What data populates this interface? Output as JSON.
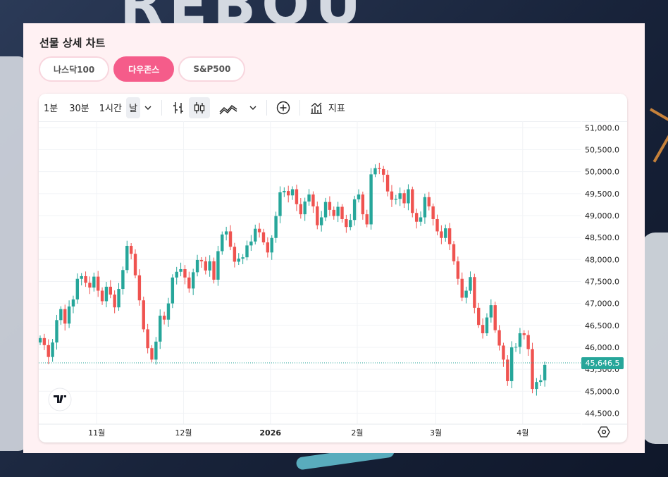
{
  "panel": {
    "title": "선물 상세 차트"
  },
  "tabs": [
    {
      "label": "나스닥100",
      "active": false
    },
    {
      "label": "다우존스",
      "active": true
    },
    {
      "label": "S&P500",
      "active": false
    }
  ],
  "toolbar": {
    "intervals": [
      "1분",
      "30분",
      "1시간",
      "날"
    ],
    "selected_interval": "날",
    "indicators_label": "지표",
    "icons": [
      "chevron-down-icon",
      "bar-chart-icon",
      "candlestick-icon",
      "area-chart-icon",
      "chevron-down-icon",
      "plus-circle-icon",
      "indicators-icon"
    ]
  },
  "chart_data": {
    "type": "candlestick",
    "title": "",
    "xlabel": "",
    "ylabel": "",
    "ylim": [
      44250,
      51150
    ],
    "y_ticks": [
      "51,000.0",
      "50,500.0",
      "50,000.0",
      "49,500.0",
      "49,000.0",
      "48,500.0",
      "48,000.0",
      "47,500.0",
      "47,000.0",
      "46,500.0",
      "46,000.0",
      "45,500.0",
      "45,000.0",
      "44,500.0"
    ],
    "y_tick_values": [
      51000,
      50500,
      50000,
      49500,
      49000,
      48500,
      48000,
      47500,
      47000,
      46500,
      46000,
      45500,
      45000,
      44500
    ],
    "x_ticks": [
      {
        "label": "11월",
        "bold": false,
        "index": 14
      },
      {
        "label": "12월",
        "bold": false,
        "index": 35
      },
      {
        "label": "2026",
        "bold": true,
        "index": 56
      },
      {
        "label": "2월",
        "bold": false,
        "index": 77
      },
      {
        "label": "3월",
        "bold": false,
        "index": 96
      },
      {
        "label": "4월",
        "bold": false,
        "index": 117
      }
    ],
    "last_price": "45,646.5",
    "last_price_value": 45646.5,
    "up_color": "#26a69a",
    "down_color": "#ef5350",
    "closes": [
      46210,
      46050,
      45780,
      46110,
      46620,
      46870,
      46540,
      46930,
      47090,
      47560,
      47620,
      47470,
      47360,
      47610,
      47290,
      47050,
      47380,
      47200,
      46910,
      47330,
      47760,
      48310,
      48130,
      47640,
      47070,
      46410,
      45980,
      45720,
      46130,
      46720,
      46630,
      47000,
      47590,
      47720,
      47780,
      47590,
      47340,
      47710,
      47990,
      47960,
      47750,
      47960,
      47540,
      48190,
      48570,
      48640,
      48290,
      47950,
      48020,
      48050,
      48320,
      48410,
      48700,
      48620,
      48390,
      48160,
      48490,
      48990,
      49530,
      49560,
      49460,
      49600,
      49260,
      49030,
      49320,
      49480,
      49210,
      48780,
      48960,
      49310,
      49130,
      48990,
      49200,
      48920,
      48740,
      48900,
      49370,
      49480,
      49030,
      48800,
      49940,
      50080,
      50060,
      49930,
      49550,
      49360,
      49380,
      49510,
      49280,
      49600,
      49060,
      48860,
      48960,
      49420,
      49210,
      48920,
      48640,
      48490,
      48710,
      48350,
      47960,
      47560,
      47130,
      47290,
      47600,
      46900,
      46510,
      46320,
      46680,
      46960,
      46390,
      46040,
      45720,
      45230,
      46000,
      46010,
      46320,
      46280,
      45960,
      45050,
      45210,
      45250,
      45600
    ]
  }
}
